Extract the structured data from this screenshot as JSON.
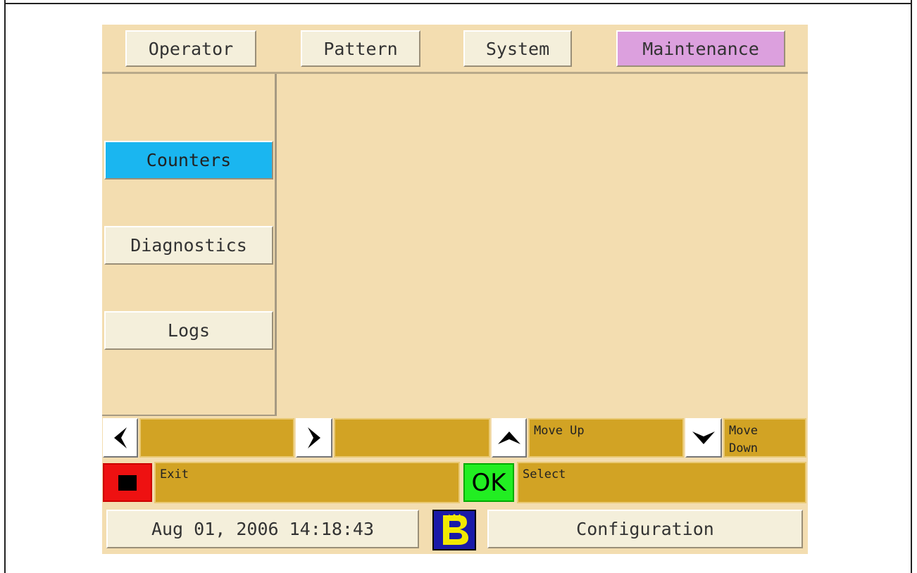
{
  "tabs": [
    {
      "label": "Operator",
      "active": false
    },
    {
      "label": "Pattern",
      "active": false
    },
    {
      "label": "System",
      "active": false
    },
    {
      "label": "Maintenance",
      "active": true
    }
  ],
  "sidebar": {
    "items": [
      {
        "label": "Counters",
        "selected": true
      },
      {
        "label": "Diagnostics",
        "selected": false
      },
      {
        "label": "Logs",
        "selected": false
      }
    ]
  },
  "softkeys": {
    "left_label": "",
    "right_label": "",
    "up_label": "Move Up",
    "down_label": "Move Down",
    "exit_label": "Exit",
    "ok_button": "OK",
    "select_label": "Select"
  },
  "status": {
    "datetime": "Aug 01, 2006 14:18:43",
    "mode": "Configuration"
  },
  "icons": {
    "left": "arrow-left-icon",
    "right": "arrow-right-icon",
    "up": "arrow-up-icon",
    "down": "arrow-down-icon",
    "stop": "stop-icon",
    "logo": "brand-logo-icon"
  },
  "colors": {
    "background": "#f3ddb0",
    "active_tab": "#dca0de",
    "selected_item": "#1ab6f0",
    "softkey_bar": "#d2a324",
    "exit": "#ee1111",
    "ok": "#22ee22",
    "logo_blue": "#1a1aa8",
    "logo_yellow": "#f2e800"
  }
}
